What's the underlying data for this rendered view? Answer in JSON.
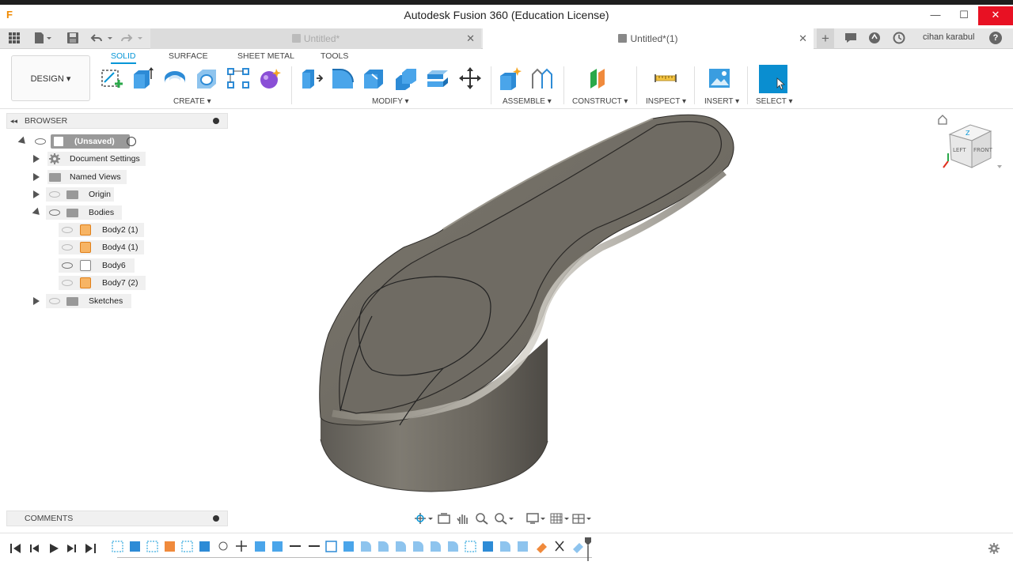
{
  "window": {
    "title": "Autodesk Fusion 360 (Education License)",
    "app_icon": "F",
    "minimize": "—",
    "maximize": "☐",
    "close": "✕"
  },
  "tabs": {
    "inactive_label": "Untitled*",
    "active_label": "Untitled*(1)",
    "close_glyph": "✕",
    "new_tab_glyph": "+",
    "user_name": "cihan karabul",
    "help_glyph": "?"
  },
  "toolbar": {
    "workspace": "DESIGN ▾",
    "tab_names": [
      "SOLID",
      "SURFACE",
      "SHEET METAL",
      "TOOLS"
    ],
    "groups": [
      "CREATE ▾",
      "MODIFY ▾",
      "ASSEMBLE ▾",
      "CONSTRUCT ▾",
      "INSPECT ▾",
      "INSERT ▾",
      "SELECT ▾"
    ]
  },
  "browser": {
    "header": "BROWSER",
    "root": "(Unsaved)",
    "items": [
      {
        "label": "Document Settings"
      },
      {
        "label": "Named Views"
      },
      {
        "label": "Origin"
      },
      {
        "label": "Bodies"
      },
      {
        "label": "Body2 (1)"
      },
      {
        "label": "Body4 (1)"
      },
      {
        "label": "Body6"
      },
      {
        "label": "Body7 (2)"
      },
      {
        "label": "Sketches"
      }
    ]
  },
  "comments": {
    "header": "COMMENTS"
  },
  "viewcube": {
    "top": "Z",
    "left": "LEFT",
    "front": "FRONT"
  },
  "colors": {
    "accent": "#0696d7",
    "close_red": "#e81123",
    "body_orange": "#e0801a",
    "model_gray": "#6e6a62"
  }
}
